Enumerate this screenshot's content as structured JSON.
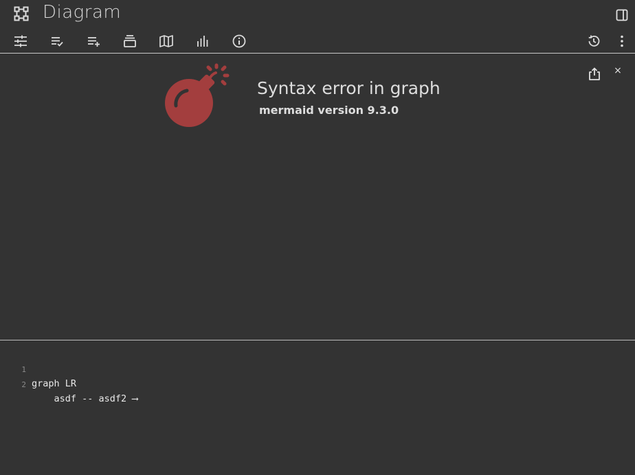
{
  "header": {
    "title": "Diagram",
    "app_icon": "diagram-icon",
    "side_toggle_icon": "side-panel-icon"
  },
  "toolbar": {
    "left_icons": [
      "tune-icon",
      "checklist-icon",
      "playlist-add-icon",
      "layers-icon",
      "map-icon",
      "bar-chart-icon",
      "info-icon"
    ],
    "right_icons": [
      "history-icon",
      "more-vert-icon"
    ]
  },
  "preview": {
    "error_title": "Syntax error in graph",
    "error_version": "mermaid version 9.3.0",
    "share_icon": "share-icon",
    "close_label": "×",
    "bomb_color": "#a33e3e"
  },
  "editor": {
    "lines": [
      {
        "number": "1",
        "text": "graph LR"
      },
      {
        "number": "2",
        "text": "    asdf -- asdf2 ⟶"
      }
    ]
  },
  "colors": {
    "background": "#333333",
    "text": "#e6e6e6",
    "accent_error": "#a33e3e"
  }
}
